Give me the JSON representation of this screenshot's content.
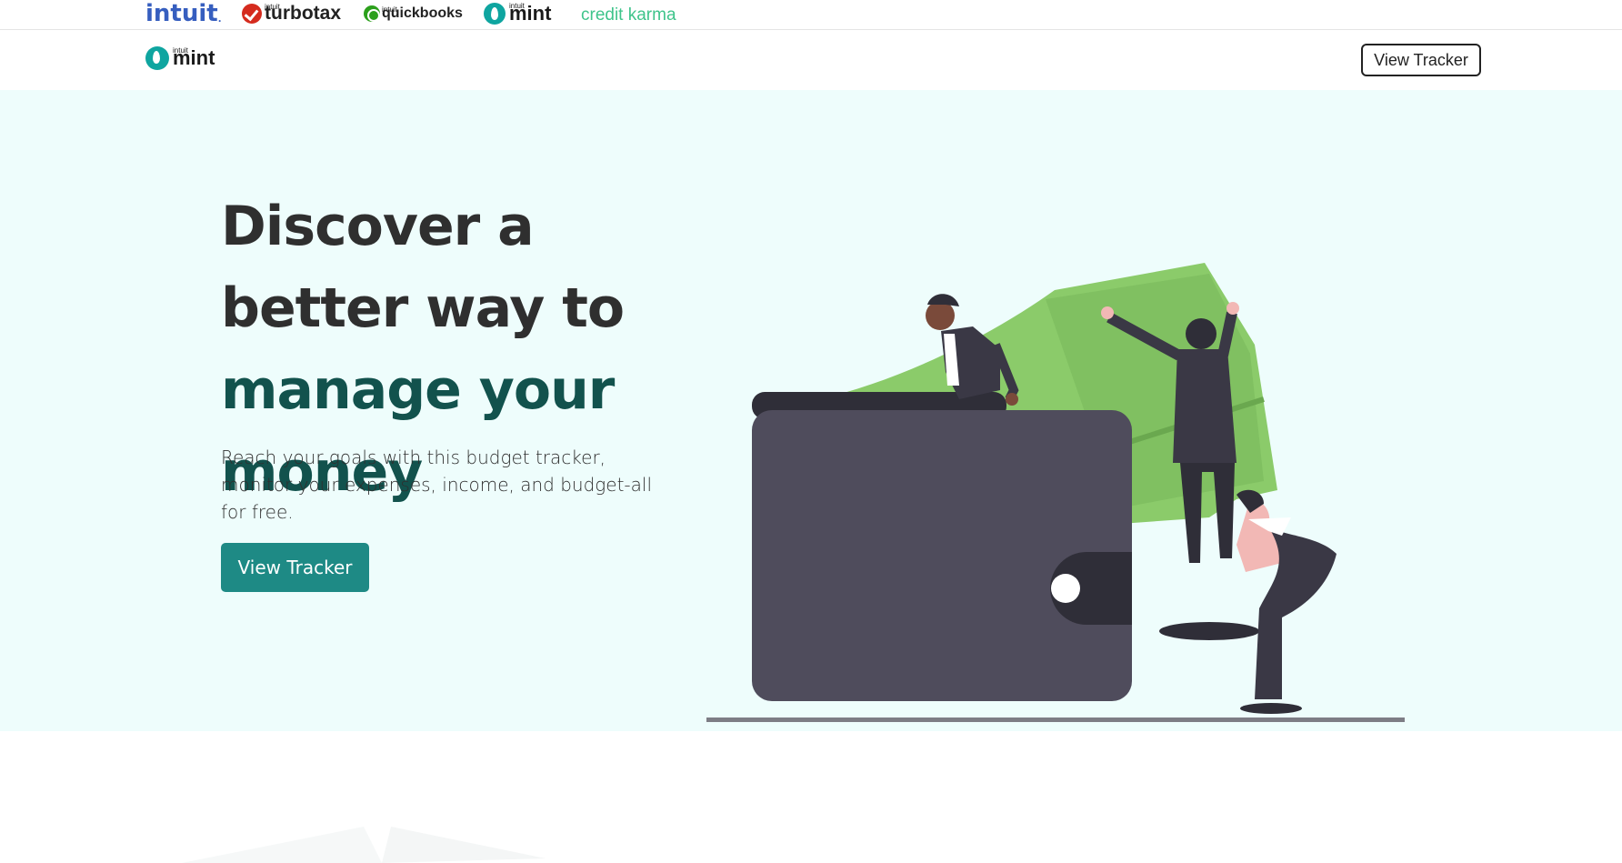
{
  "brand_bar": {
    "brands": [
      {
        "name": "intuit",
        "label": "intuit"
      },
      {
        "name": "turbotax",
        "label": "turbotax",
        "sup": "intuit"
      },
      {
        "name": "quickbooks",
        "label": "quickbooks",
        "sup": "intuit"
      },
      {
        "name": "mint",
        "label": "mint",
        "sup": "intuit"
      },
      {
        "name": "credit-karma",
        "label": "credit karma"
      }
    ]
  },
  "nav": {
    "logo_sup": "intuit",
    "logo_text": "mint",
    "button_label": "View Tracker"
  },
  "hero": {
    "title_part1": "Discover a better way to ",
    "title_accent": "manage your money",
    "subtitle": "Reach your goals with this budget tracker, monitor your expenses, income, and budget-all for free.",
    "button_label": "View Tracker"
  },
  "colors": {
    "hero_bg": "#eefdfc",
    "accent_dark": "#12524d",
    "button_bg": "#1e8a85",
    "money_green": "#8bcb6a",
    "wallet": "#4f4c5c",
    "intuit_blue": "#365ebf",
    "credit_karma_green": "#3fc48b"
  }
}
